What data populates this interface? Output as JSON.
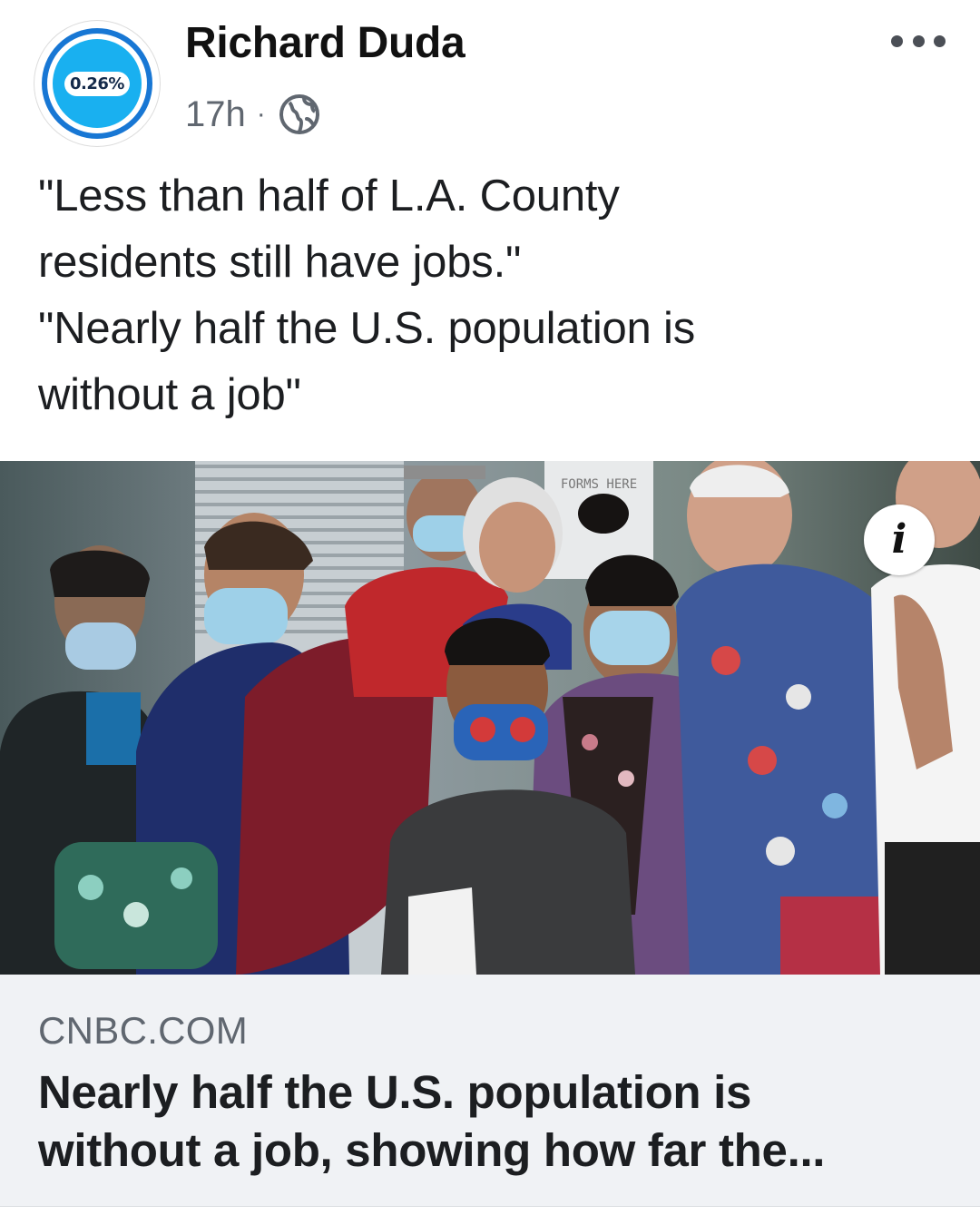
{
  "post": {
    "author": {
      "name": "Richard Duda",
      "avatar_text": "0.26%"
    },
    "timestamp": "17h",
    "separator": "·",
    "privacy_icon": "globe-icon",
    "more_icon": "more-options-icon",
    "text_lines": [
      "\"Less than half of L.A. County",
      "residents still have jobs.\"",
      "\"Nearly half the U.S. population is",
      "without a job\""
    ]
  },
  "link_preview": {
    "image_sign_text": "FORMS HERE",
    "info_icon": "info-icon",
    "info_glyph": "i",
    "domain": "CNBC.COM",
    "title_lines": [
      "Nearly half the U.S. population is",
      "without a job, showing how far the..."
    ]
  },
  "colors": {
    "avatar_ring": "#1877d4",
    "avatar_fill": "#19b0f0",
    "meta_gray": "#606770",
    "link_bg": "#f0f2f5"
  }
}
